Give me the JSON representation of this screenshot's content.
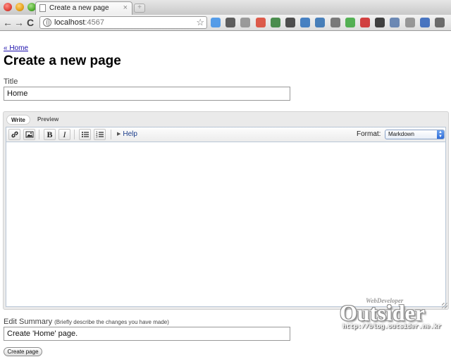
{
  "browser": {
    "tab_title": "Create a new page",
    "tab_close": "×",
    "new_tab": "+",
    "url_host": "localhost",
    "url_port": ":4567",
    "nav_back": "←",
    "nav_forward": "→",
    "nav_reload": "C",
    "bookmark_star": "☆",
    "extensions": [
      {
        "name": "delicious-icon",
        "color": "#3b8ee8"
      },
      {
        "name": "readitlater-icon",
        "color": "#444444"
      },
      {
        "name": "mail-icon",
        "color": "#8c8c8c"
      },
      {
        "name": "magnet-icon",
        "color": "#d9412e"
      },
      {
        "name": "tabs-icon",
        "color": "#2f7d33"
      },
      {
        "name": "screenshot-icon",
        "color": "#333333"
      },
      {
        "name": "search-ext-icon",
        "color": "#2a6fbb"
      },
      {
        "name": "rss-icon",
        "color": "#2b6cb0"
      },
      {
        "name": "eyedropper-icon",
        "color": "#666666"
      },
      {
        "name": "frog-icon",
        "color": "#3aa63a"
      },
      {
        "name": "notify-icon",
        "color": "#cc2222"
      },
      {
        "name": "gear-icon",
        "color": "#222222"
      },
      {
        "name": "window-icon",
        "color": "#5577aa"
      },
      {
        "name": "settings-icon",
        "color": "#888888"
      },
      {
        "name": "puzzle-icon",
        "color": "#2b5fb8"
      },
      {
        "name": "clipboard-icon",
        "color": "#555555"
      }
    ]
  },
  "page": {
    "home_link": "« Home",
    "heading": "Create a new page",
    "title_label": "Title",
    "title_value": "Home",
    "editor": {
      "tab_write": "Write",
      "tab_preview": "Preview",
      "bold": "B",
      "italic": "I",
      "help": "Help",
      "format_label": "Format:",
      "format_selected": "Markdown",
      "content": ""
    },
    "summary_label": "Edit Summary",
    "summary_hint": "(Briefly describe the changes you have made)",
    "summary_value": "Create 'Home' page.",
    "submit": "Create page"
  },
  "watermark": {
    "small": "WebDeveloper",
    "big": "Outsider",
    "url": "http://blog.outsider.ne.kr"
  }
}
